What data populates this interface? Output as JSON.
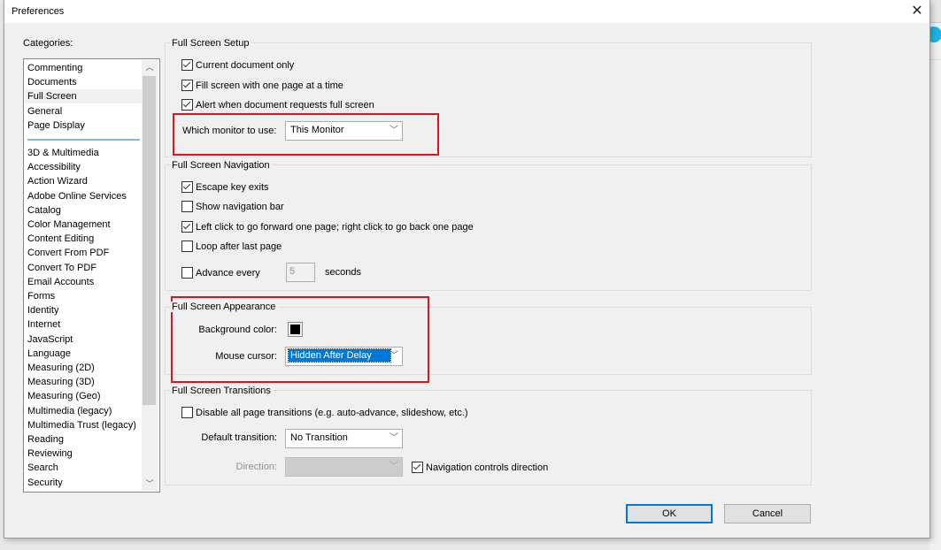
{
  "window": {
    "title": "Preferences",
    "close_icon": "close-icon"
  },
  "categories": {
    "label": "Categories:",
    "pinned": [
      {
        "label": "Commenting",
        "selected": false
      },
      {
        "label": "Documents",
        "selected": false
      },
      {
        "label": "Full Screen",
        "selected": true
      },
      {
        "label": "General",
        "selected": false
      },
      {
        "label": "Page Display",
        "selected": false
      }
    ],
    "items": [
      "3D & Multimedia",
      "Accessibility",
      "Action Wizard",
      "Adobe Online Services",
      "Catalog",
      "Color Management",
      "Content Editing",
      "Convert From PDF",
      "Convert To PDF",
      "Email Accounts",
      "Forms",
      "Identity",
      "Internet",
      "JavaScript",
      "Language",
      "Measuring (2D)",
      "Measuring (3D)",
      "Measuring (Geo)",
      "Multimedia (legacy)",
      "Multimedia Trust (legacy)",
      "Reading",
      "Reviewing",
      "Search",
      "Security"
    ]
  },
  "setup": {
    "title": "Full Screen Setup",
    "current_document_only": {
      "label": "Current document only",
      "checked": true
    },
    "fill_screen": {
      "label": "Fill screen with one page at a time",
      "checked": true
    },
    "alert_request": {
      "label": "Alert when document requests full screen",
      "checked": true
    },
    "monitor_label": "Which monitor to use:",
    "monitor_value": "This Monitor"
  },
  "navigation": {
    "title": "Full Screen Navigation",
    "escape_exits": {
      "label": "Escape key exits",
      "checked": true
    },
    "show_nav_bar": {
      "label": "Show navigation bar",
      "checked": false
    },
    "left_click": {
      "label": "Left click to go forward one page; right click to go back one page",
      "checked": true
    },
    "loop": {
      "label": "Loop after last page",
      "checked": false
    },
    "advance": {
      "label": "Advance every",
      "checked": false
    },
    "advance_seconds": "5",
    "seconds_label": "seconds"
  },
  "appearance": {
    "title": "Full Screen Appearance",
    "bg_color_label": "Background color:",
    "bg_color": "#000000",
    "mouse_cursor_label": "Mouse cursor:",
    "mouse_cursor_value": "Hidden After Delay"
  },
  "transitions": {
    "title": "Full Screen Transitions",
    "disable_all": {
      "label": "Disable all page transitions (e.g. auto-advance, slideshow, etc.)",
      "checked": false
    },
    "default_label": "Default transition:",
    "default_value": "No Transition",
    "direction_label": "Direction:",
    "direction_value": "",
    "nav_controls": {
      "label": "Navigation controls direction",
      "checked": true
    }
  },
  "buttons": {
    "ok": "OK",
    "cancel": "Cancel"
  },
  "colors": {
    "highlight_border": "#e0141e",
    "selection": "#0078d7"
  }
}
